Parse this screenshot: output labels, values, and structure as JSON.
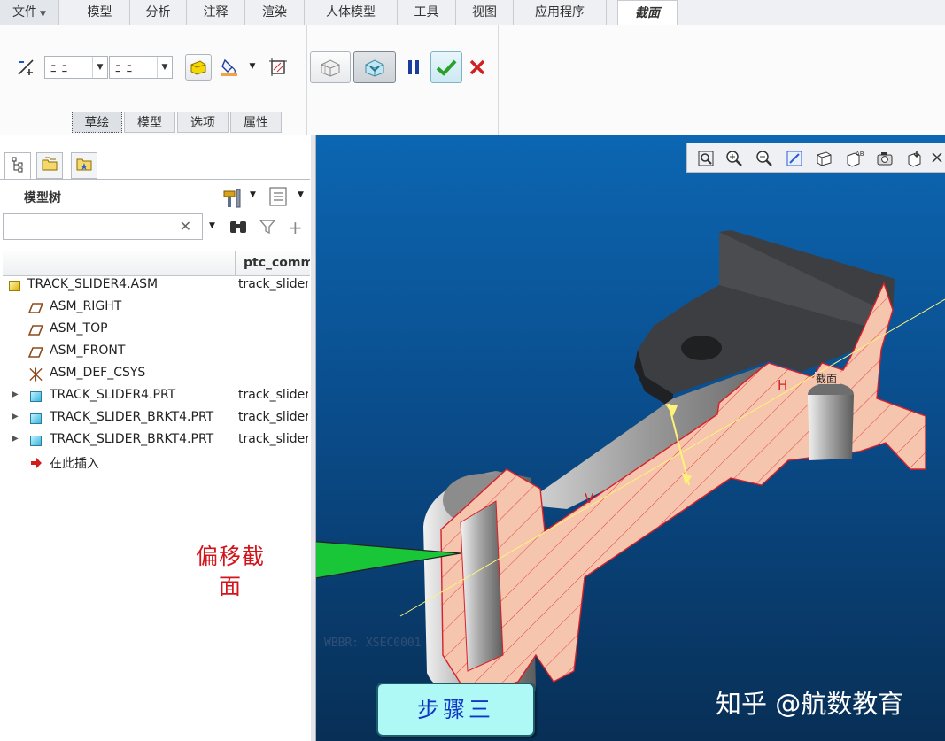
{
  "ribbon": {
    "tabs": [
      {
        "label": "文件",
        "dropdown": true
      },
      {
        "label": "模型"
      },
      {
        "label": "分析"
      },
      {
        "label": "注释"
      },
      {
        "label": "渲染"
      },
      {
        "label": "人体模型"
      },
      {
        "label": "工具"
      },
      {
        "label": "视图"
      },
      {
        "label": "应用程序"
      },
      {
        "label": "截面",
        "active": true
      }
    ],
    "combo1_value": "ﾆ ﾆ",
    "combo2_value": "ﾆ ﾆ",
    "subtabs": [
      "草绘",
      "模型",
      "选项",
      "属性"
    ],
    "icons": [
      "offset-distance-icon",
      "flip-icon",
      "cap-color-icon",
      "hatch-icon",
      "clip-display-icon",
      "preview-icon",
      "pause-icon",
      "ok-icon",
      "cancel-icon"
    ],
    "colors": {
      "ok": "#2aa02a",
      "cancel": "#d12020",
      "pause": "#1a3c9c"
    }
  },
  "model_tree": {
    "title": "模型树",
    "search_value": "",
    "column2_header": "ptc_comm",
    "rows": [
      {
        "name": "TRACK_SLIDER4.ASM",
        "col2": "track_slider",
        "icon": "assembly-icon",
        "level": 0,
        "expandable": false
      },
      {
        "name": "ASM_RIGHT",
        "col2": "",
        "icon": "datum-plane-icon",
        "level": 1,
        "expandable": false
      },
      {
        "name": "ASM_TOP",
        "col2": "",
        "icon": "datum-plane-icon",
        "level": 1,
        "expandable": false
      },
      {
        "name": "ASM_FRONT",
        "col2": "",
        "icon": "datum-plane-icon",
        "level": 1,
        "expandable": false
      },
      {
        "name": "ASM_DEF_CSYS",
        "col2": "",
        "icon": "csys-icon",
        "level": 1,
        "expandable": false
      },
      {
        "name": "TRACK_SLIDER4.PRT",
        "col2": "track_slider",
        "icon": "part-icon",
        "level": 1,
        "expandable": true
      },
      {
        "name": "TRACK_SLIDER_BRKT4.PRT",
        "col2": "track_slider",
        "icon": "part-icon",
        "level": 1,
        "expandable": true
      },
      {
        "name": "TRACK_SLIDER_BRKT4.PRT",
        "col2": "track_slider",
        "icon": "part-icon",
        "level": 1,
        "expandable": true
      },
      {
        "name": "在此插入",
        "col2": "",
        "icon": "insert-here-icon",
        "level": 1,
        "expandable": false
      }
    ]
  },
  "viewport": {
    "toolbar_icons": [
      "refit-icon",
      "zoom-in-icon",
      "zoom-out-icon",
      "repaint-icon",
      "display-style-icon",
      "saved-orientations-icon",
      "view-manager-icon",
      "spin-center-icon",
      "annotation-display-icon"
    ],
    "labels": {
      "h_label": "H",
      "v_label": "V",
      "section_tag": "截面",
      "faint_text": "WBBR: XSEC0001"
    },
    "callout": "偏移截面",
    "step_label": "步骤三",
    "watermark": "知乎 @航数教育"
  }
}
